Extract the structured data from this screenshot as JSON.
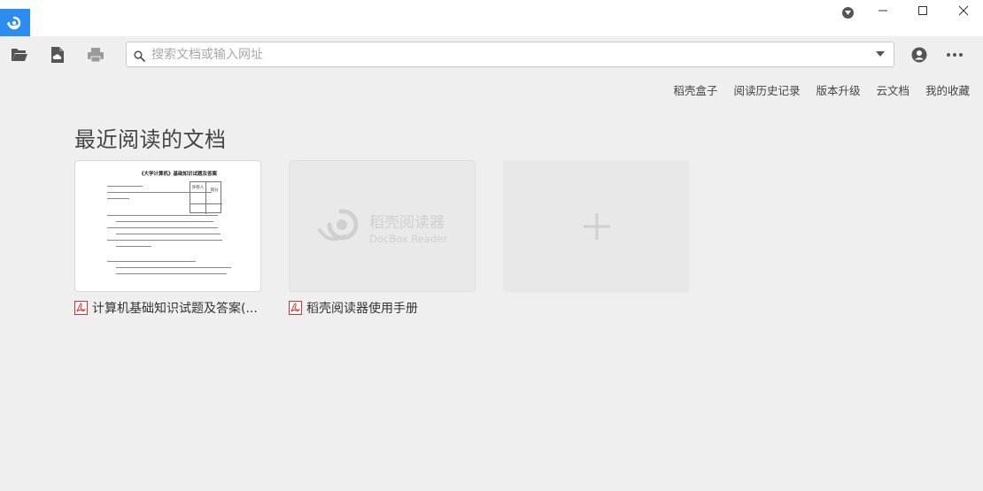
{
  "titlebar": {
    "logo_icon": "docbox-logo-icon",
    "controls": [
      "download-icon",
      "minimize-icon",
      "maximize-icon",
      "close-icon"
    ]
  },
  "toolbar": {
    "open_icon": "folder-open-icon",
    "cloud_icon": "cloud-file-icon",
    "print_icon": "printer-icon",
    "search_placeholder": "搜索文档或输入网址",
    "search_value": "",
    "user_icon": "user-icon",
    "more_icon": "more-icon"
  },
  "top_links": [
    "稻壳盒子",
    "阅读历史记录",
    "版本升级",
    "云文档",
    "我的收藏"
  ],
  "section_title": "最近阅读的文档",
  "recent": [
    {
      "name": "计算机基础知识试题及答案(...",
      "type": "pdf",
      "preview": {
        "title": "《大学计算机》基础知识试题及答案",
        "table_headers": [
          "评卷人",
          "得分"
        ]
      }
    },
    {
      "name": "稻壳阅读器使用手册",
      "type": "pdf",
      "watermark_cn": "稻壳阅读器",
      "watermark_en": "DocBox Reader"
    }
  ],
  "colors": {
    "accent": "#2d8cf0",
    "pdf_red": "#d9302c",
    "background": "#efefef"
  }
}
